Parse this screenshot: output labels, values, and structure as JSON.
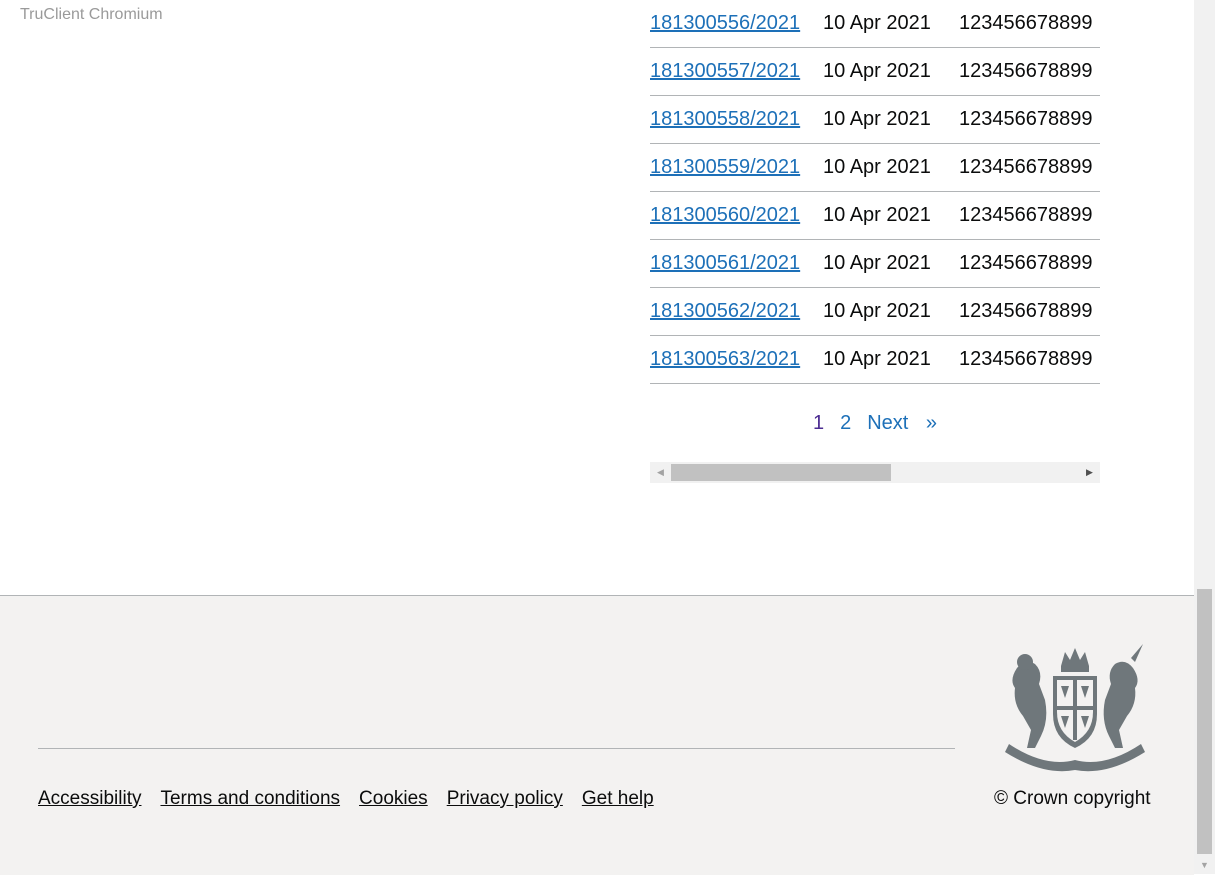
{
  "watermark": "TruClient Chromium",
  "rows": [
    {
      "ref": "181300556/2021",
      "date": "10 Apr 2021",
      "num": "123456678899"
    },
    {
      "ref": "181300557/2021",
      "date": "10 Apr 2021",
      "num": "123456678899"
    },
    {
      "ref": "181300558/2021",
      "date": "10 Apr 2021",
      "num": "123456678899"
    },
    {
      "ref": "181300559/2021",
      "date": "10 Apr 2021",
      "num": "123456678899"
    },
    {
      "ref": "181300560/2021",
      "date": "10 Apr 2021",
      "num": "123456678899"
    },
    {
      "ref": "181300561/2021",
      "date": "10 Apr 2021",
      "num": "123456678899"
    },
    {
      "ref": "181300562/2021",
      "date": "10 Apr 2021",
      "num": "123456678899"
    },
    {
      "ref": "181300563/2021",
      "date": "10 Apr 2021",
      "num": "123456678899"
    }
  ],
  "pagination": {
    "current": "1",
    "page2": "2",
    "next": "Next",
    "next_arrow": "»"
  },
  "footer": {
    "links": [
      "Accessibility",
      "Terms and conditions",
      "Cookies",
      "Privacy policy",
      "Get help"
    ],
    "copyright": "© Crown copyright",
    "crest_icon": "royal-coat-of-arms-icon"
  },
  "colors": {
    "link": "#1d70b8",
    "visited": "#4c2c92",
    "footer_bg": "#f3f2f1"
  }
}
